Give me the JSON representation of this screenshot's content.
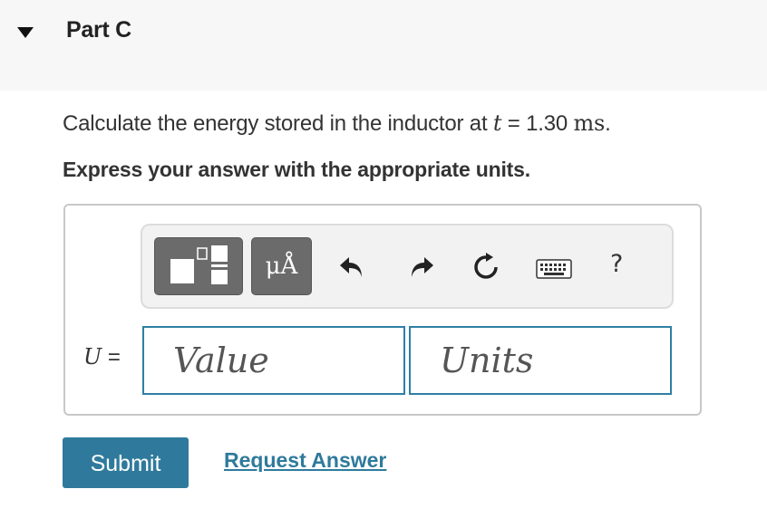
{
  "part": {
    "title": "Part C"
  },
  "question": {
    "prefix": "Calculate the energy stored in the inductor at ",
    "variable": "t",
    "equals": " = 1.30 ",
    "unit": "ms",
    "suffix": "."
  },
  "instruction": "Express your answer with the appropriate units.",
  "toolbar": {
    "units_label": "μÅ",
    "help_label": "?",
    "icons": [
      "templates-icon",
      "units-icon",
      "undo-icon",
      "redo-icon",
      "reset-icon",
      "keyboard-icon",
      "help-icon"
    ]
  },
  "answer": {
    "variable": "U",
    "equals": " =",
    "value_placeholder": "Value",
    "units_placeholder": "Units"
  },
  "actions": {
    "submit_label": "Submit",
    "request_label": "Request Answer"
  },
  "colors": {
    "accent": "#2f7a9c",
    "toolbar_button": "#6b6b6b"
  }
}
